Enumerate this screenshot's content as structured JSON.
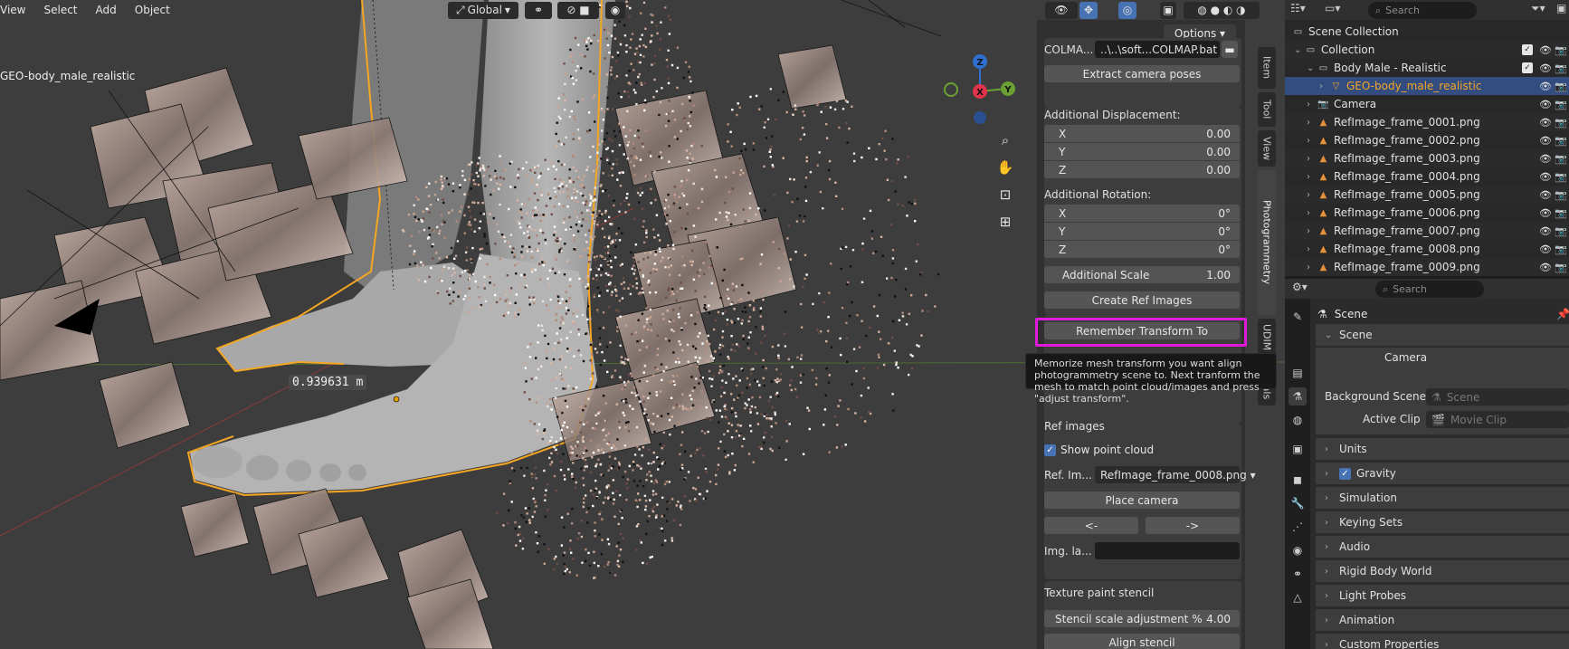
{
  "viewport": {
    "menu": [
      "View",
      "Select",
      "Add",
      "Object"
    ],
    "header": {
      "orientation_label": "Global",
      "transform_icon": "transform-orientation-icon",
      "snap_icon": "snap-icon",
      "proportional_icon": "proportional-edit-icon"
    },
    "object_name": "GEO-body_male_realistic",
    "measure_value": "0.939631 m",
    "gizmo": {
      "x_label": "X",
      "y_label": "Y",
      "z_label": "Z"
    }
  },
  "npanel": {
    "options_label": "Options",
    "colmap_label": "COLMA...",
    "colmap_path": "..\\..\\soft...COLMAP.bat",
    "extract_button": "Extract camera poses",
    "displacement": {
      "title": "Additional Displacement:",
      "fields": [
        {
          "axis": "X",
          "value": "0.00"
        },
        {
          "axis": "Y",
          "value": "0.00"
        },
        {
          "axis": "Z",
          "value": "0.00"
        }
      ]
    },
    "rotation": {
      "title": "Additional Rotation:",
      "fields": [
        {
          "axis": "X",
          "value": "0°"
        },
        {
          "axis": "Y",
          "value": "0°"
        },
        {
          "axis": "Z",
          "value": "0°"
        }
      ]
    },
    "scale": {
      "label": "Additional Scale",
      "value": "1.00"
    },
    "create_ref_button": "Create Ref Images",
    "remember_button": "Remember Transform To",
    "tooltip": "Memorize mesh transform you want align photogrammetry scene to. Next tranform the mesh to match point cloud/images and press \"adjust transform\".",
    "ref_images": {
      "title": "Ref images",
      "show_point_cloud": "Show point cloud",
      "ref_label": "Ref. Im...",
      "ref_value": "RefImage_frame_0008.png",
      "place_camera": "Place camera",
      "prev": "<-",
      "next": "->",
      "img_label": "Img. la...",
      "img_value": ""
    },
    "stencil": {
      "title": "Texture paint stencil",
      "scale_label": "Stencil scale adjustment %",
      "scale_value": "4.00",
      "align_button": "Align stencil"
    },
    "tabs": [
      "Item",
      "Tool",
      "View",
      "Photogrammetry",
      "UDIM Materials"
    ]
  },
  "outliner": {
    "search_placeholder": "Search",
    "rows": [
      {
        "label": "Scene Collection",
        "icon": "scene-collection-icon"
      },
      {
        "label": "Collection",
        "icon": "collection-icon"
      },
      {
        "label": "Body Male - Realistic",
        "icon": "collection-icon"
      },
      {
        "label": "GEO-body_male_realistic",
        "icon": "mesh-icon"
      },
      {
        "label": "Camera",
        "icon": "camera-icon"
      },
      {
        "label": "RefImage_frame_0001.png",
        "icon": "image-icon"
      },
      {
        "label": "RefImage_frame_0002.png",
        "icon": "image-icon"
      },
      {
        "label": "RefImage_frame_0003.png",
        "icon": "image-icon"
      },
      {
        "label": "RefImage_frame_0004.png",
        "icon": "image-icon"
      },
      {
        "label": "RefImage_frame_0005.png",
        "icon": "image-icon"
      },
      {
        "label": "RefImage_frame_0006.png",
        "icon": "image-icon"
      },
      {
        "label": "RefImage_frame_0007.png",
        "icon": "image-icon"
      },
      {
        "label": "RefImage_frame_0008.png",
        "icon": "image-icon"
      },
      {
        "label": "RefImage_frame_0009.png",
        "icon": "image-icon"
      }
    ]
  },
  "properties": {
    "search_placeholder": "Search",
    "context": "Scene",
    "scene_panel": "Scene",
    "camera_label": "Camera",
    "background_label": "Background Scene",
    "background_value": "Scene",
    "clip_label": "Active Clip",
    "clip_value": "Movie Clip",
    "panels": [
      "Units",
      "Gravity",
      "Simulation",
      "Keying Sets",
      "Audio",
      "Rigid Body World",
      "Light Probes",
      "Animation",
      "Custom Properties"
    ],
    "colors": {
      "accent": "#4772b3",
      "highlight": "#e01ad9",
      "selection_orange": "#f5a623"
    }
  }
}
